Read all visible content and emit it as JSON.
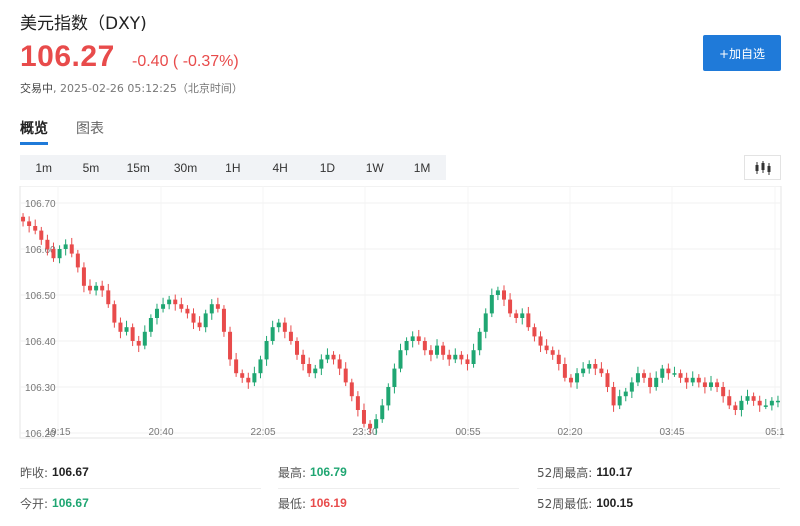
{
  "header": {
    "title": "美元指数（DXY)",
    "price": "106.27",
    "change": "-0.40 ( -0.37%)",
    "status_state": "交易中",
    "status_time": "2025-02-26 05:12:25（北京时间）",
    "watch_button": "+加自选"
  },
  "main_tabs": [
    "概览",
    "图表"
  ],
  "periods": [
    "1m",
    "5m",
    "15m",
    "30m",
    "1H",
    "4H",
    "1D",
    "1W",
    "1M"
  ],
  "active_period": "5m",
  "colors": {
    "up": "#1fa672",
    "down": "#e84b4b",
    "accent": "#1f7ad9"
  },
  "chart_data": {
    "type": "candlestick",
    "title": "",
    "xlabel": "",
    "ylabel": "",
    "ylim": [
      106.2,
      106.72
    ],
    "y_ticks": [
      "106.70",
      "106.60",
      "106.50",
      "106.40",
      "106.30",
      "106.20"
    ],
    "x_ticks": [
      "19:15",
      "20:40",
      "22:05",
      "23:30",
      "00:55",
      "02:20",
      "03:45",
      "05:1"
    ],
    "closes": [
      106.66,
      106.65,
      106.64,
      106.62,
      106.6,
      106.58,
      106.6,
      106.61,
      106.59,
      106.56,
      106.52,
      106.51,
      106.52,
      106.51,
      106.48,
      106.44,
      106.42,
      106.43,
      106.4,
      106.39,
      106.42,
      106.45,
      106.47,
      106.48,
      106.49,
      106.48,
      106.47,
      106.46,
      106.44,
      106.43,
      106.46,
      106.48,
      106.47,
      106.42,
      106.36,
      106.33,
      106.32,
      106.31,
      106.33,
      106.36,
      106.4,
      106.43,
      106.44,
      106.42,
      106.4,
      106.37,
      106.35,
      106.33,
      106.34,
      106.36,
      106.37,
      106.36,
      106.34,
      106.31,
      106.28,
      106.25,
      106.22,
      106.21,
      106.23,
      106.26,
      106.3,
      106.34,
      106.38,
      106.4,
      106.41,
      106.4,
      106.38,
      106.37,
      106.39,
      106.37,
      106.36,
      106.37,
      106.36,
      106.35,
      106.38,
      106.42,
      106.46,
      106.5,
      106.51,
      106.49,
      106.46,
      106.45,
      106.46,
      106.43,
      106.41,
      106.39,
      106.38,
      106.37,
      106.35,
      106.32,
      106.31,
      106.33,
      106.34,
      106.35,
      106.34,
      106.33,
      106.3,
      106.26,
      106.28,
      106.29,
      106.31,
      106.33,
      106.32,
      106.3,
      106.32,
      106.34,
      106.33,
      106.33,
      106.32,
      106.31,
      106.32,
      106.31,
      106.3,
      106.31,
      106.3,
      106.28,
      106.26,
      106.25,
      106.27,
      106.28,
      106.27,
      106.26,
      106.26,
      106.27,
      106.27
    ]
  },
  "stats": {
    "prev_close_label": "昨收:",
    "prev_close": "106.67",
    "high_label": "最高:",
    "high": "106.79",
    "high52_label": "52周最高:",
    "high52": "110.17",
    "open_label": "今开:",
    "open": "106.67",
    "low_label": "最低:",
    "low": "106.19",
    "low52_label": "52周最低:",
    "low52": "100.15"
  }
}
